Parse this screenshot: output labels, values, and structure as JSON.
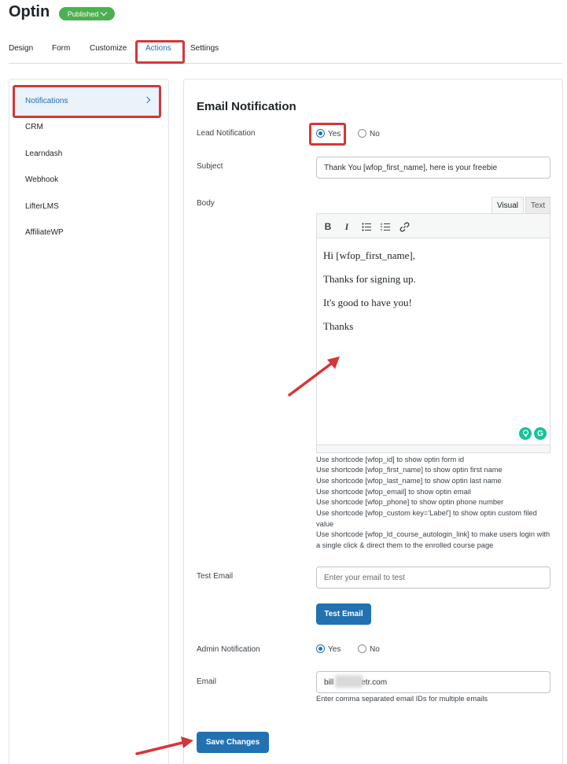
{
  "header": {
    "title": "Optin",
    "status_badge": "Published"
  },
  "tabs": [
    {
      "label": "Design"
    },
    {
      "label": "Form"
    },
    {
      "label": "Customize"
    },
    {
      "label": "Actions"
    },
    {
      "label": "Settings"
    }
  ],
  "sidebar": {
    "items": [
      {
        "label": "Notifications"
      },
      {
        "label": "CRM"
      },
      {
        "label": "Learndash"
      },
      {
        "label": "Webhook"
      },
      {
        "label": "LifterLMS"
      },
      {
        "label": "AffiliateWP"
      }
    ]
  },
  "main": {
    "section_title": "Email Notification",
    "lead_notification": {
      "label": "Lead Notification",
      "options": [
        "Yes",
        "No"
      ],
      "selected": "Yes"
    },
    "subject": {
      "label": "Subject",
      "value": "Thank You [wfop_first_name], here is your freebie"
    },
    "body": {
      "label": "Body",
      "tab_visual": "Visual",
      "tab_text": "Text",
      "toolbar": [
        "bold-icon",
        "italic-icon",
        "bulleted-list-icon",
        "numbered-list-icon",
        "link-icon"
      ],
      "lines": [
        "Hi [wfop_first_name],",
        "Thanks for signing up.",
        "It's good to have you!",
        "Thanks"
      ]
    },
    "help_lines": [
      "Use shortcode [wfop_id] to show optin form id",
      "Use shortcode [wfop_first_name] to show optin first name",
      "Use shortcode [wfop_last_name] to show optin last name",
      "Use shortcode [wfop_email] to show optin email",
      "Use shortcode [wfop_phone] to show optin phone number",
      "Use shortcode [wfop_custom key='Label'] to show optin custom filed value",
      "Use shortcode [wfop_ld_course_autologin_link] to make users login with a single click & direct them to the enrolled course page"
    ],
    "test_email": {
      "label": "Test Email",
      "placeholder": "Enter your email to test",
      "button": "Test Email"
    },
    "admin_notification": {
      "label": "Admin Notification",
      "options": [
        "Yes",
        "No"
      ],
      "selected": "Yes"
    },
    "email": {
      "label": "Email",
      "value_start": "bill",
      "value_end": "etr.com",
      "hint": "Enter comma separated email IDs for multiple emails"
    },
    "save_button": "Save Changes"
  },
  "colors": {
    "accent": "#2271b1",
    "published": "#4caf50",
    "highlight": "#d63638",
    "grammarly": "#15c39a"
  }
}
